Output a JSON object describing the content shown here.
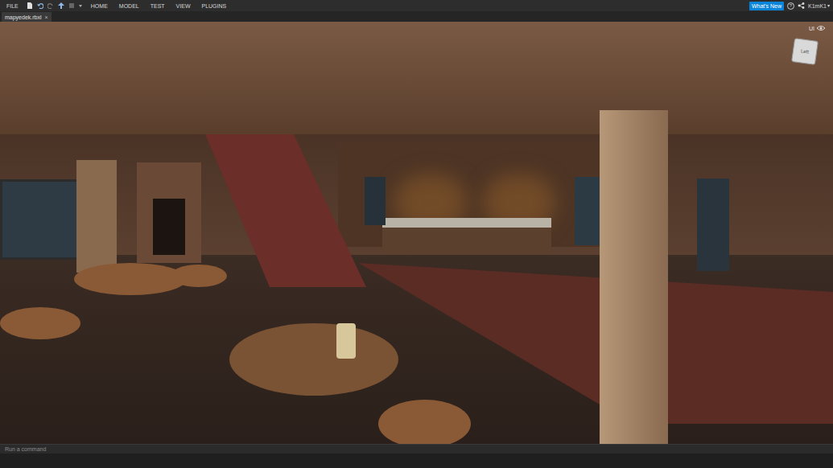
{
  "menu": {
    "file": "FILE",
    "tabs": [
      {
        "label": "HOME",
        "selected": false
      },
      {
        "label": "MODEL",
        "selected": false
      },
      {
        "label": "TEST",
        "selected": false
      },
      {
        "label": "VIEW",
        "selected": false
      },
      {
        "label": "PLUGINS",
        "selected": false
      }
    ]
  },
  "whats_new": "What's New",
  "help": "?",
  "user": {
    "name": "K1mK1",
    "caret": "▾"
  },
  "document_tab": {
    "label": "mapyedek.rbxl",
    "close": "×",
    "selected": true
  },
  "viewport": {
    "ui_toggle": "UI",
    "view_cube": {
      "face": "Left"
    }
  },
  "command_bar": {
    "placeholder": "Run a command"
  }
}
